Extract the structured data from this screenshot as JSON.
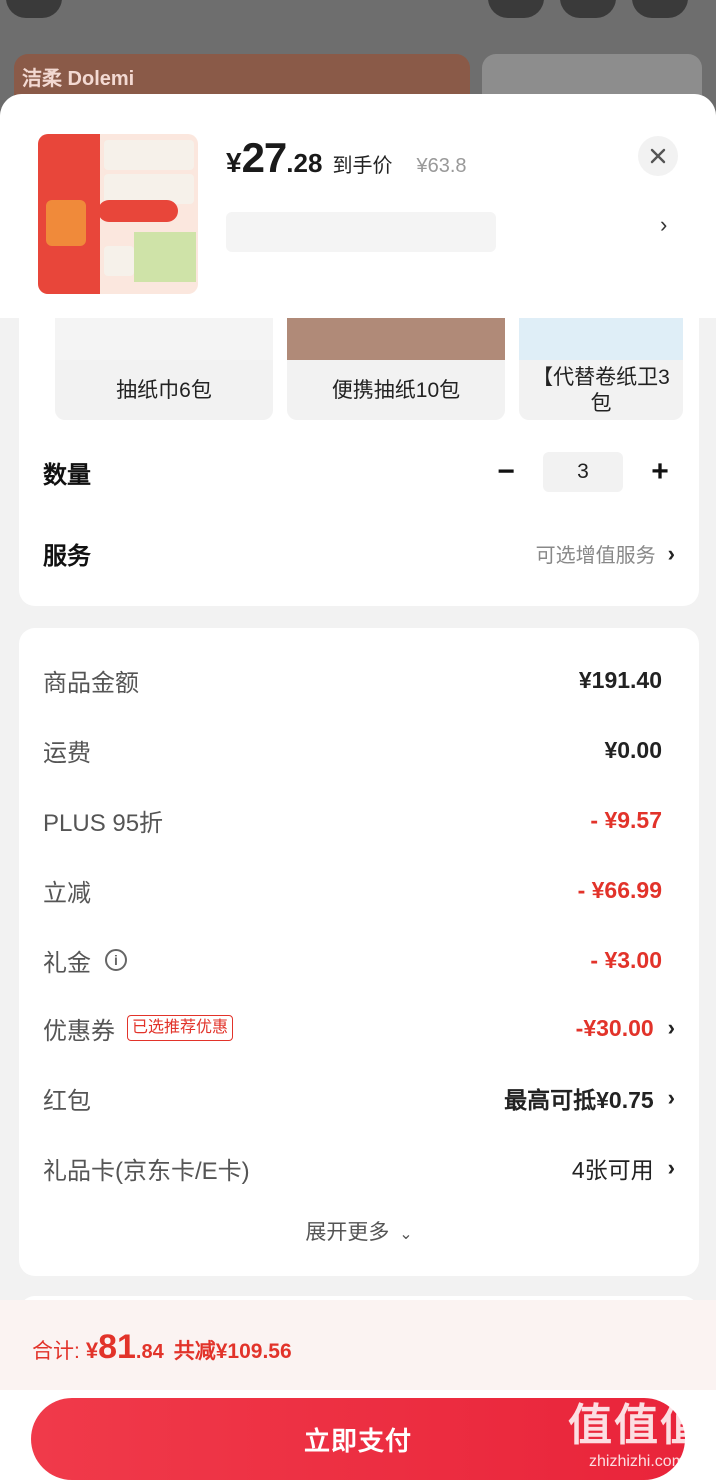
{
  "background": {
    "brand_logo": "洁柔 Dolemi"
  },
  "header": {
    "price_yen": "¥",
    "price_int": "27",
    "price_dec": ".28",
    "price_tag": "到手价",
    "original_price": "¥63.8"
  },
  "variants": [
    {
      "label": "抽纸巾6包"
    },
    {
      "label": "便携抽纸10包"
    },
    {
      "label": "【代替卷纸卫3包"
    }
  ],
  "quantity": {
    "label": "数量",
    "minus": "−",
    "value": "3",
    "plus": "+"
  },
  "service": {
    "label": "服务",
    "value": "可选增值服务"
  },
  "fees": {
    "goods_amount": {
      "label": "商品金额",
      "value": "¥191.40"
    },
    "shipping": {
      "label": "运费",
      "value": "¥0.00"
    },
    "plus_discount": {
      "label": "PLUS 95折",
      "value": "- ¥9.57"
    },
    "instant_off": {
      "label": "立减",
      "value": "- ¥66.99"
    },
    "gift_money": {
      "label": "礼金",
      "value": "- ¥3.00"
    },
    "coupon": {
      "label": "优惠券",
      "badge": "已选推荐优惠",
      "value": "-¥30.00"
    },
    "red_packet": {
      "label": "红包",
      "value": "最高可抵¥0.75"
    },
    "gift_card": {
      "label": "礼品卡(京东卡/E卡)",
      "value": "4张可用"
    },
    "expand": "展开更多"
  },
  "footer": {
    "total_label": "合计:",
    "total_yen": "¥",
    "total_int": "81",
    "total_dec": ".84",
    "saved": "共减¥109.56",
    "pay_button": "立即支付"
  },
  "watermark": {
    "title": "值值值",
    "subtitle": "zhizhizhi.com"
  },
  "colors": {
    "accent_red": "#e2332a",
    "pay_button": "#ef3346"
  },
  "icons": [
    "close-icon",
    "chevron-right-icon",
    "info-icon",
    "chevron-down-icon"
  ]
}
